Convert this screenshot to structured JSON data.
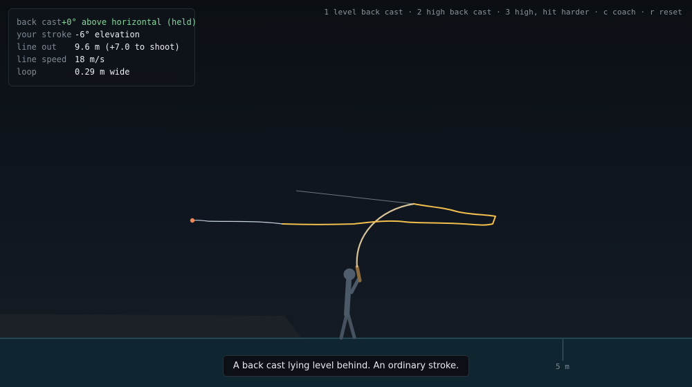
{
  "hud": {
    "rows": [
      {
        "label": "back cast",
        "value": "+0° above horizontal  (held)"
      },
      {
        "label": "your stroke",
        "value": "-6° elevation"
      },
      {
        "label": "line out",
        "value": "9.6 m  (+7.0 to shoot)"
      },
      {
        "label": "line speed",
        "value": "18 m/s"
      },
      {
        "label": "loop",
        "value": "0.29 m wide"
      }
    ]
  },
  "controls_hint": "1 level back cast · 2 high back cast · 3 high, hit harder · c coach · r reset",
  "scale": {
    "label": "5 m"
  },
  "message": "A back cast lying level behind. An ordinary stroke.",
  "colors": {
    "fly_line": "#f2bf4e",
    "leader": "#c8d6e2",
    "fly": "#ee8a58",
    "rod": "#d9c49a",
    "handle": "#8a6a3e",
    "angler": "#4b5968",
    "water": "#123039",
    "shore": "#1d2229",
    "good_value": "#86d39b"
  }
}
